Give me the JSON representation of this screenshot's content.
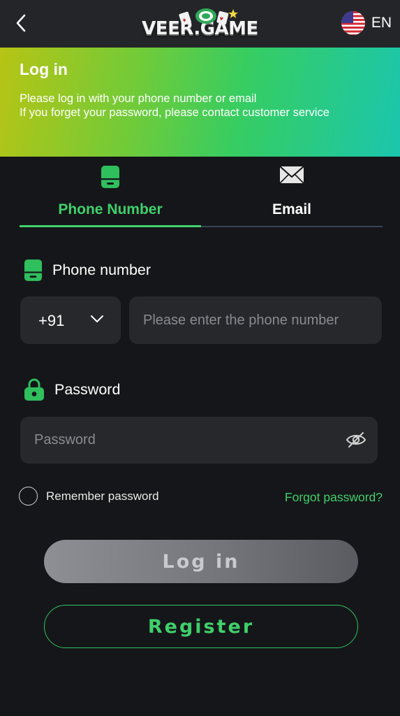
{
  "header": {
    "logo_text": "VEER.GAME",
    "language": "EN"
  },
  "banner": {
    "title": "Log in",
    "line1": "Please log in with your phone number or email",
    "line2": "If you forget your password, please contact customer service"
  },
  "tabs": [
    {
      "label": "Phone Number",
      "icon": "phone-icon",
      "active": true
    },
    {
      "label": "Email",
      "icon": "envelope-icon",
      "active": false
    }
  ],
  "phone": {
    "label": "Phone number",
    "country_code": "+91",
    "placeholder": "Please enter the phone number"
  },
  "password": {
    "label": "Password",
    "placeholder": "Password"
  },
  "remember_label": "Remember password",
  "forgot_label": "Forgot password?",
  "buttons": {
    "login": "Log in",
    "register": "Register"
  },
  "colors": {
    "accent": "#3fd06b",
    "background": "#151619",
    "input_bg": "#27282c"
  }
}
